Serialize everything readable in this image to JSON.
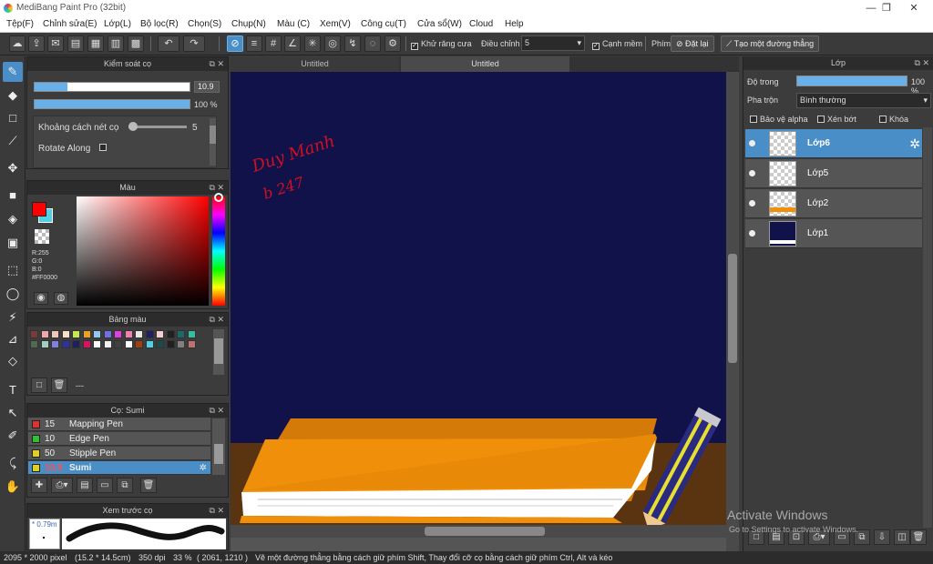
{
  "window": {
    "title": "MediBang Paint Pro (32bit)",
    "minimize": "—",
    "maximize": "❐",
    "close": "✕"
  },
  "menu": [
    "Tệp(F)",
    "Chỉnh sửa(E)",
    "Lớp(L)",
    "Bộ lọc(R)",
    "Chọn(S)",
    "Chụp(N)",
    "Màu (C)",
    "Xem(V)",
    "Công cụ(T)",
    "Cửa sổ(W)",
    "Cloud",
    "Help"
  ],
  "toolbar": {
    "antialias_label": "Khử răng cưa",
    "adjust_label": "Điều chỉnh",
    "adjust_value": "5",
    "sharp_label": "Cạnh mềm",
    "key_label": "Phím",
    "reset_label": "Đặt lại",
    "straight_label": "Tạo một đường thẳng"
  },
  "brush_control": {
    "title": "Kiểm soát cọ",
    "size_value": "10.9",
    "size_fraction": 0.21,
    "opacity_value": "100 %",
    "opacity_fraction": 1.0,
    "spacing_label": "Khoảng cách nét cọ",
    "spacing_value": "5",
    "rotate_label": "Rotate Along"
  },
  "color_panel": {
    "title": "Màu",
    "r": "R:255",
    "g": "G:0",
    "b": "B:0",
    "hex": "#FF0000",
    "fg_color": "#ff0000",
    "bg_color": "#4fd0e8"
  },
  "palette_panel": {
    "title": "Bảng màu",
    "name": "---",
    "swatches": [
      "#7a3a3a",
      "#f0a8a8",
      "#f0c8b8",
      "#f8e0c8",
      "#c8e850",
      "#f0a020",
      "#90c8f0",
      "#7070e0",
      "#e040e0",
      "#f080b0",
      "#e8e8e8",
      "#202060",
      "#f0d0d0",
      "#202020",
      "#1a6a6a",
      "#30c0a0",
      "#506a50",
      "#a0d0c0",
      "#8080e0",
      "#3030a0",
      "#202060",
      "#e01060",
      "#ffffff",
      "#f0f0f0",
      "#404040",
      "#ffffff",
      "#a04010",
      "#50d0e8",
      "#1a4a4a",
      "#202020",
      "#808080",
      "#c07070"
    ]
  },
  "brush_panel": {
    "title": "Cọ: Sumi",
    "brushes": [
      {
        "size": "15",
        "name": "Mapping Pen",
        "color": "#e03030"
      },
      {
        "size": "10",
        "name": "Edge Pen",
        "color": "#30c030"
      },
      {
        "size": "50",
        "name": "Stipple Pen",
        "color": "#e0d020"
      },
      {
        "size": "10.9",
        "name": "Sumi",
        "color": "#e0d020"
      }
    ]
  },
  "preview_panel": {
    "title": "Xem trước cọ",
    "size": "* 0.79m"
  },
  "tabs": [
    "Untitled",
    "Untitled"
  ],
  "signature": [
    "Duy Manh",
    "b 247"
  ],
  "layer_panel": {
    "title": "Lớp",
    "opacity_label": "Độ trong",
    "opacity_value": "100 %",
    "opacity_fraction": 1.0,
    "blend_label": "Pha trộn",
    "blend_value": "Bình thường",
    "protect_alpha": "Bảo vệ alpha",
    "clipping": "Xén bớt",
    "lock": "Khóa",
    "layers": [
      "Lớp6",
      "Lớp5",
      "Lớp2",
      "Lớp1"
    ]
  },
  "activation": {
    "title": "Activate Windows",
    "subtitle": "Go to Settings to activate Windows."
  },
  "status": {
    "size": "2095 * 2000 pixel",
    "physical": "(15.2 * 14.5cm)",
    "dpi": "350 dpi",
    "zoom": "33 %",
    "coords": "( 2061, 1210 )",
    "hint": "Vẽ một đường thẳng bằng cách giữ phím Shift, Thay đổi cỡ cọ bằng cách giữ phím Ctrl, Alt và kéo"
  },
  "colors": {
    "accent": "#4a8ec8",
    "canvas_sky": "#12124a",
    "table": "#5a3410",
    "book": "#f0900a"
  }
}
